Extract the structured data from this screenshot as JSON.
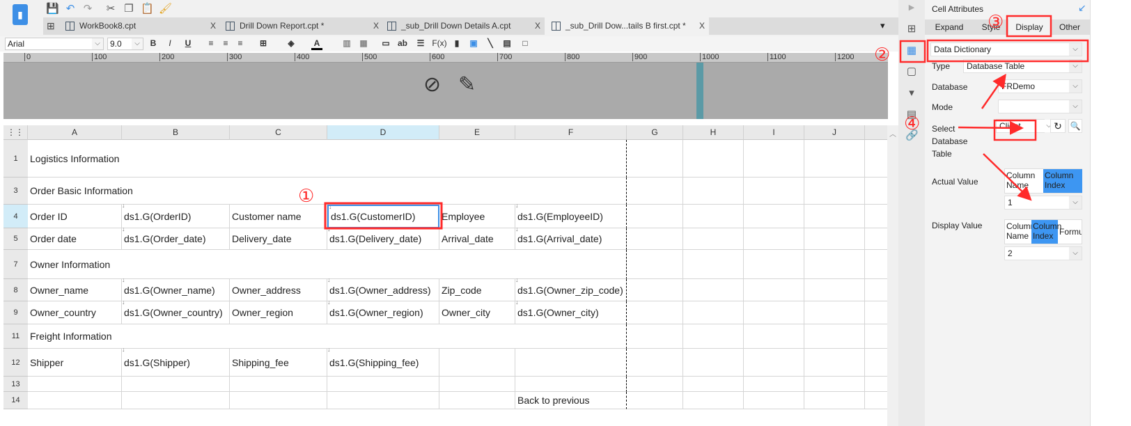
{
  "toolbar": {
    "icons": [
      "save-icon",
      "undo-icon",
      "redo-icon",
      "cut-icon",
      "copy-icon",
      "paste-icon",
      "format-painter-icon"
    ]
  },
  "tabs": [
    {
      "label": "WorkBook8.cpt"
    },
    {
      "label": "Drill Down Report.cpt *"
    },
    {
      "label": "_sub_Drill Down Details A.cpt"
    },
    {
      "label": "_sub_Drill Dow...tails B first.cpt *"
    }
  ],
  "format": {
    "font": "Arial",
    "size": "9.0",
    "bold": "B",
    "italic": "I",
    "underline": "U",
    "text_tool": "ab",
    "formula_tool": "F(x)"
  },
  "ruler": [
    "0",
    "100",
    "200",
    "300",
    "400",
    "500",
    "600",
    "700",
    "800",
    "900",
    "1000",
    "1100",
    "1200"
  ],
  "grid": {
    "columns": [
      "A",
      "B",
      "C",
      "D",
      "E",
      "F",
      "G",
      "H",
      "I",
      "J"
    ],
    "rows": [
      {
        "num": "1",
        "cells": [
          "Logistics Information"
        ]
      },
      {
        "num": "3",
        "cells": [
          "Order Basic Information"
        ]
      },
      {
        "num": "4",
        "cells": [
          "Order ID",
          "ds1.G(OrderID)",
          "Customer name",
          "ds1.G(CustomerID)",
          "Employee",
          "ds1.G(EmployeeID)"
        ]
      },
      {
        "num": "5",
        "cells": [
          "Order date",
          "ds1.G(Order_date)",
          "Delivery_date",
          "ds1.G(Delivery_date)",
          "Arrival_date",
          "ds1.G(Arrival_date)"
        ]
      },
      {
        "num": "7",
        "cells": [
          "Owner Information"
        ]
      },
      {
        "num": "8",
        "cells": [
          "Owner_name",
          "ds1.G(Owner_name)",
          "Owner_address",
          "ds1.G(Owner_address)",
          "Zip_code",
          "ds1.G(Owner_zip_code)"
        ]
      },
      {
        "num": "9",
        "cells": [
          "Owner_country",
          "ds1.G(Owner_country)",
          "Owner_region",
          "ds1.G(Owner_region)",
          "Owner_city",
          "ds1.G(Owner_city)"
        ]
      },
      {
        "num": "11",
        "cells": [
          "Freight Information"
        ]
      },
      {
        "num": "12",
        "cells": [
          "Shipper",
          "ds1.G(Shipper)",
          "Shipping_fee",
          "ds1.G(Shipping_fee)"
        ]
      },
      {
        "num": "13",
        "cells": []
      },
      {
        "num": "14",
        "cells": [
          "",
          "",
          "",
          "",
          "",
          "Back to previous"
        ]
      }
    ],
    "selected_cell": "D4"
  },
  "panel": {
    "title": "Cell Attributes",
    "tabs": [
      "Expand",
      "Style",
      "Display",
      "Other"
    ],
    "active_tab": "Display",
    "mode_select": "Data Dictionary",
    "type_label": "Type",
    "type_value": "Database Table",
    "database_label": "Database",
    "database_value": "FRDemo",
    "mode_label": "Mode",
    "mode_value": "",
    "select_table_label": "Select Database Table",
    "select_table_value": "Client",
    "actual_value_label": "Actual Value",
    "actual_options": [
      "Column Name",
      "Column Index"
    ],
    "actual_value": "1",
    "display_value_label": "Display Value",
    "display_options": [
      "Column Name",
      "Column Index",
      "Formula"
    ],
    "display_value": "2"
  },
  "annotations": [
    "①",
    "②",
    "③",
    "④"
  ],
  "colors": {
    "annotation": "#ff2a2a",
    "accent": "#3d96f2",
    "selected_header": "#d2ecf8"
  }
}
